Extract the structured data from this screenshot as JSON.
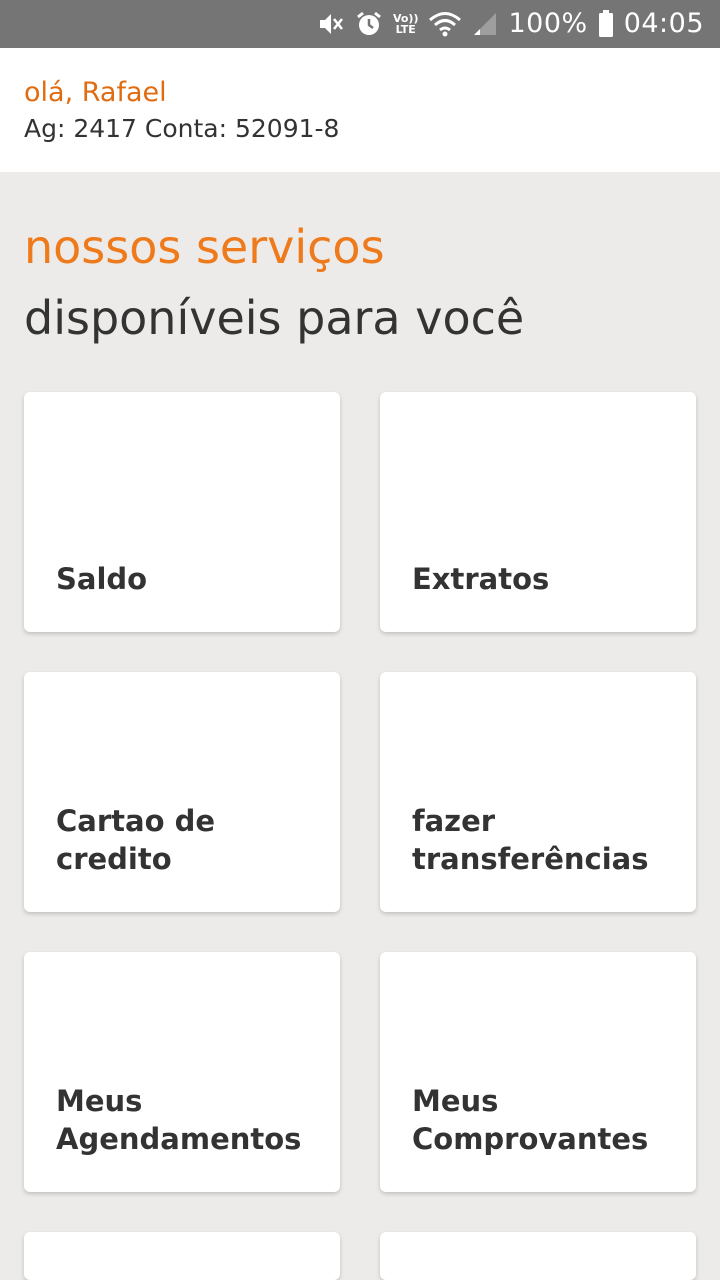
{
  "status_bar": {
    "icons": [
      "mute-icon",
      "alarm-icon",
      "volte-icon",
      "wifi-icon",
      "signal-icon",
      "battery-icon"
    ],
    "volte_top": "Vo))",
    "volte_bottom": "LTE",
    "battery_percent": "100%",
    "time": "04:05"
  },
  "header": {
    "greeting": "olá, Rafael",
    "account": "Ag: 2417 Conta: 52091-8"
  },
  "section": {
    "title": "nossos serviços",
    "subtitle": "disponíveis para você"
  },
  "services": [
    {
      "label": "Saldo"
    },
    {
      "label": "Extratos"
    },
    {
      "label": "Cartao de credito"
    },
    {
      "label": "fazer\ntransferências"
    },
    {
      "label": "Meus\nAgendamentos"
    },
    {
      "label": "Meus\nComprovantes"
    },
    {
      "label": ""
    },
    {
      "label": ""
    }
  ],
  "colors": {
    "accent": "#ee7a1b",
    "greeting": "#e06c12",
    "text": "#333333",
    "background": "#ecebe9",
    "status_bar": "#757575"
  }
}
